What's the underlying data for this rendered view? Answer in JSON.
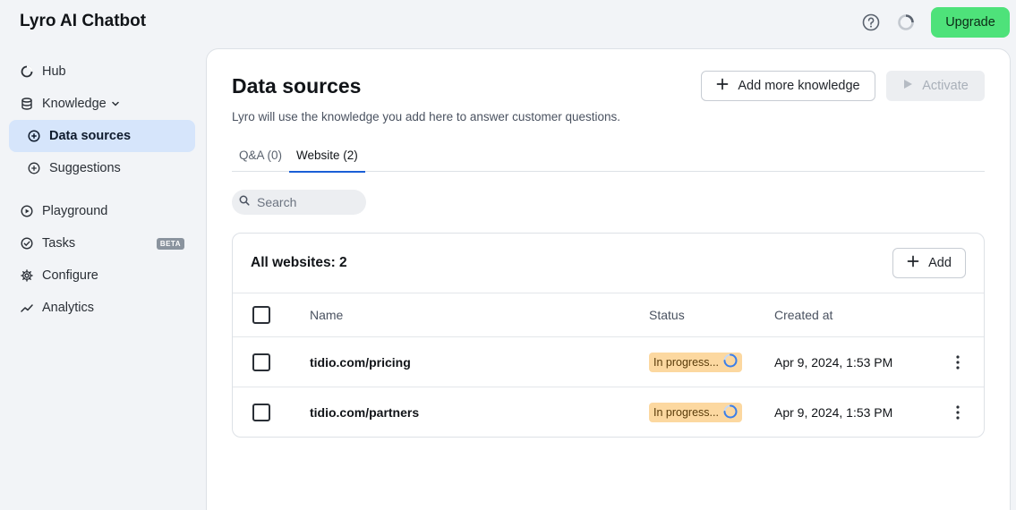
{
  "app": {
    "title": "Lyro AI Chatbot"
  },
  "topbar": {
    "upgrade_label": "Upgrade",
    "help_icon": "help-circle-icon",
    "status_icon": "loading-ring-icon"
  },
  "sidebar": {
    "items": [
      {
        "label": "Hub",
        "icon": "hub-ring-icon"
      },
      {
        "label": "Knowledge",
        "icon": "database-icon"
      },
      {
        "label": "Data sources",
        "icon": "plus-circle-icon",
        "active": true
      },
      {
        "label": "Suggestions",
        "icon": "plus-circle-icon"
      },
      {
        "label": "Playground",
        "icon": "play-circle-icon"
      },
      {
        "label": "Tasks",
        "icon": "check-circle-icon",
        "badge": "BETA"
      },
      {
        "label": "Configure",
        "icon": "gear-icon"
      },
      {
        "label": "Analytics",
        "icon": "trend-line-icon"
      }
    ]
  },
  "main": {
    "title": "Data sources",
    "subtitle": "Lyro will use the knowledge you add here to answer customer questions.",
    "add_knowledge_label": "Add more knowledge",
    "activate_label": "Activate",
    "tabs": [
      {
        "label": "Q&A (0)"
      },
      {
        "label": "Website (2)",
        "active": true
      }
    ],
    "search": {
      "placeholder": "Search",
      "value": ""
    },
    "card": {
      "title": "All websites: 2",
      "add_label": "Add",
      "columns": {
        "name": "Name",
        "status": "Status",
        "created": "Created at"
      },
      "rows": [
        {
          "name": "tidio.com/pricing",
          "status": "In progress...",
          "created": "Apr 9, 2024, 1:53 PM"
        },
        {
          "name": "tidio.com/partners",
          "status": "In progress...",
          "created": "Apr 9, 2024, 1:53 PM"
        }
      ]
    }
  },
  "colors": {
    "accent": "#1a5fd6",
    "upgrade": "#4ee27a",
    "active_nav": "#d6e5fb",
    "badge_progress": "#fcd8a0"
  }
}
